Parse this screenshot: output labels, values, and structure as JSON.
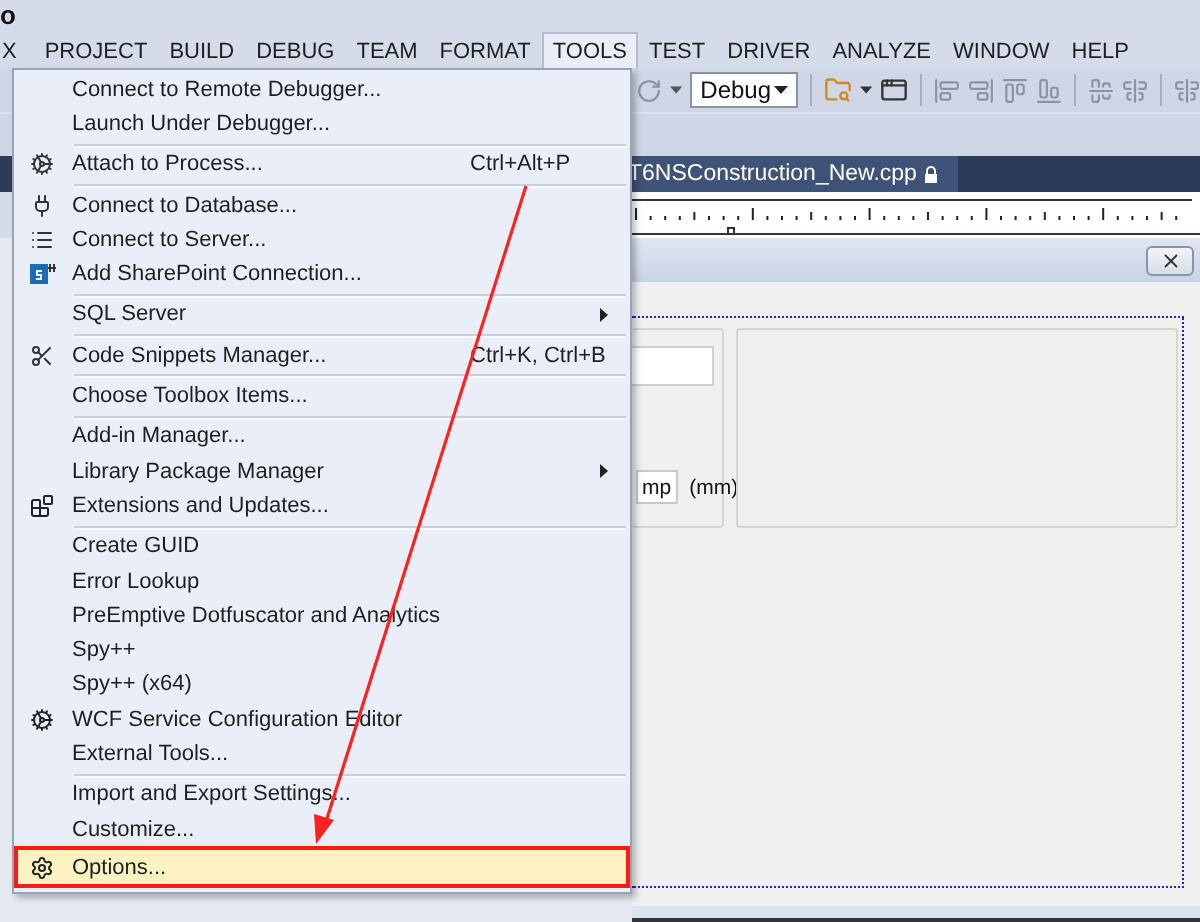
{
  "title_bar": {
    "text": "o"
  },
  "menu_bar": [
    {
      "label": "X",
      "selected": false
    },
    {
      "label": "PROJECT",
      "selected": false
    },
    {
      "label": "BUILD",
      "selected": false
    },
    {
      "label": "DEBUG",
      "selected": false
    },
    {
      "label": "TEAM",
      "selected": false
    },
    {
      "label": "FORMAT",
      "selected": false
    },
    {
      "label": "TOOLS",
      "selected": true
    },
    {
      "label": "TEST",
      "selected": false
    },
    {
      "label": "DRIVER",
      "selected": false
    },
    {
      "label": "ANALYZE",
      "selected": false
    },
    {
      "label": "WINDOW",
      "selected": false
    },
    {
      "label": "HELP",
      "selected": false
    }
  ],
  "toolbar": {
    "configuration": "Debug"
  },
  "document_tab": {
    "title": "T6NSConstruction_New.cpp"
  },
  "form": {
    "unit_field": "mp",
    "unit_label": "(mm)"
  },
  "tools_menu": [
    {
      "kind": "item",
      "label": "Connect to Remote Debugger...",
      "selected": false
    },
    {
      "kind": "item",
      "label": "Launch Under Debugger...",
      "selected": false
    },
    {
      "kind": "separator"
    },
    {
      "kind": "item",
      "label": "Attach to Process...",
      "shortcut": "Ctrl+Alt+P",
      "selected": false
    },
    {
      "kind": "separator"
    },
    {
      "kind": "item",
      "label": "Connect to Database...",
      "selected": false
    },
    {
      "kind": "item",
      "label": "Connect to Server...",
      "selected": false
    },
    {
      "kind": "item",
      "label": "Add SharePoint Connection...",
      "selected": false
    },
    {
      "kind": "separator"
    },
    {
      "kind": "submenu",
      "label": "SQL Server",
      "selected": false
    },
    {
      "kind": "separator"
    },
    {
      "kind": "item",
      "label": "Code Snippets Manager...",
      "shortcut": "Ctrl+K, Ctrl+B",
      "selected": false
    },
    {
      "kind": "separator"
    },
    {
      "kind": "item",
      "label": "Choose Toolbox Items...",
      "selected": false
    },
    {
      "kind": "separator"
    },
    {
      "kind": "item",
      "label": "Add-in Manager...",
      "selected": false
    },
    {
      "kind": "submenu",
      "label": "Library Package Manager",
      "selected": false
    },
    {
      "kind": "item",
      "label": "Extensions and Updates...",
      "selected": false
    },
    {
      "kind": "separator"
    },
    {
      "kind": "item",
      "label": "Create GUID",
      "selected": false
    },
    {
      "kind": "item",
      "label": "Error Lookup",
      "selected": false
    },
    {
      "kind": "item",
      "label": "PreEmptive Dotfuscator and Analytics",
      "selected": false
    },
    {
      "kind": "item",
      "label": "Spy++",
      "selected": false
    },
    {
      "kind": "item",
      "label": "Spy++ (x64)",
      "selected": false
    },
    {
      "kind": "item",
      "label": "WCF Service Configuration Editor",
      "selected": false
    },
    {
      "kind": "item",
      "label": "External Tools...",
      "selected": false
    },
    {
      "kind": "separator"
    },
    {
      "kind": "item",
      "label": "Import and Export Settings...",
      "selected": false
    },
    {
      "kind": "item",
      "label": "Customize...",
      "selected": false
    },
    {
      "kind": "item",
      "label": "Options...",
      "selected": true
    }
  ]
}
